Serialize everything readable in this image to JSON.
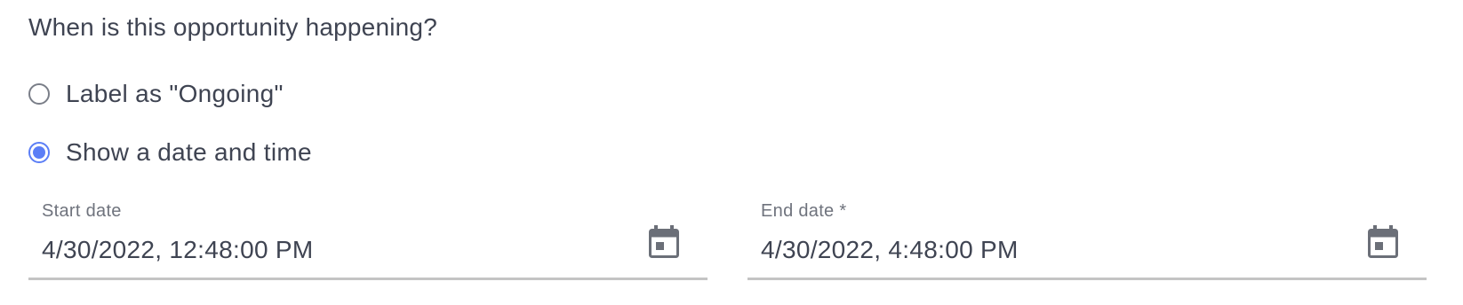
{
  "question": "When is this opportunity happening?",
  "options": [
    {
      "label": "Label as \"Ongoing\"",
      "checked": false
    },
    {
      "label": "Show a date and time",
      "checked": true
    }
  ],
  "start_date": {
    "label": "Start date",
    "value": "4/30/2022, 12:48:00 PM",
    "icon": "calendar-icon"
  },
  "end_date": {
    "label": "End date *",
    "value": "4/30/2022, 4:48:00 PM",
    "icon": "calendar-icon"
  },
  "colors": {
    "accent": "#5b7ef6",
    "text": "#3f4452",
    "muted_text": "#6f737d",
    "underline": "#c4c4c4",
    "icon": "#6b6f78"
  }
}
